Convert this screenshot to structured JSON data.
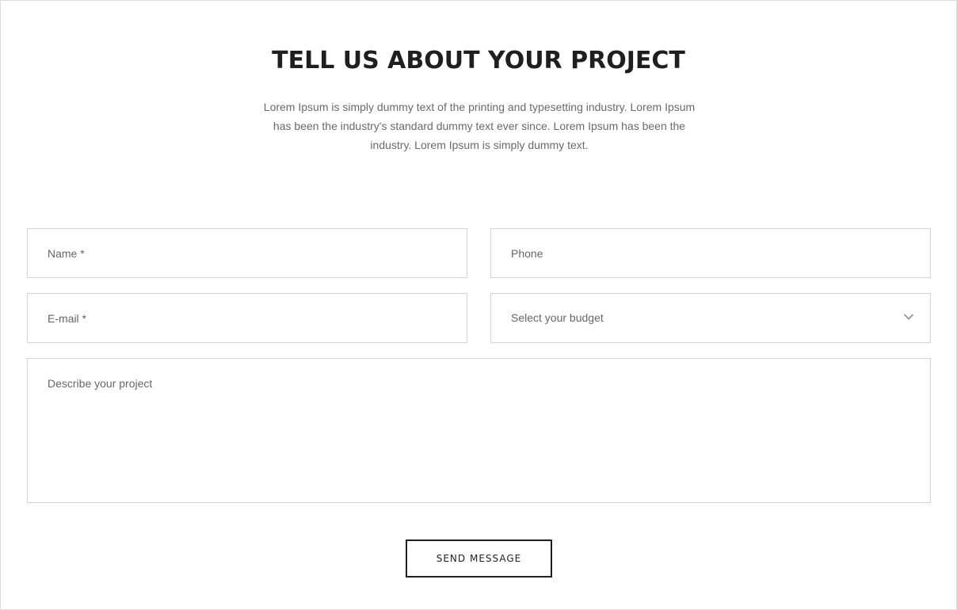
{
  "section": {
    "title": "TELL US ABOUT YOUR PROJECT",
    "description": "Lorem Ipsum is simply dummy text of the printing and typesetting industry. Lorem Ipsum has been the industry's standard dummy text ever since. Lorem Ipsum has been the industry. Lorem Ipsum is simply dummy text."
  },
  "form": {
    "name_placeholder": "Name *",
    "phone_placeholder": "Phone",
    "email_placeholder": "E-mail *",
    "budget_selected": "Select your budget",
    "project_placeholder": "Describe your project",
    "submit_label": "SEND MESSAGE"
  },
  "icons": {
    "budget_dropdown": "chevron-down-icon"
  },
  "colors": {
    "heading": "#1f1f1f",
    "body_text": "#6a6a6a",
    "field_border": "#d4d4d4",
    "button_border": "#1f1f1f",
    "background": "#ffffff"
  }
}
